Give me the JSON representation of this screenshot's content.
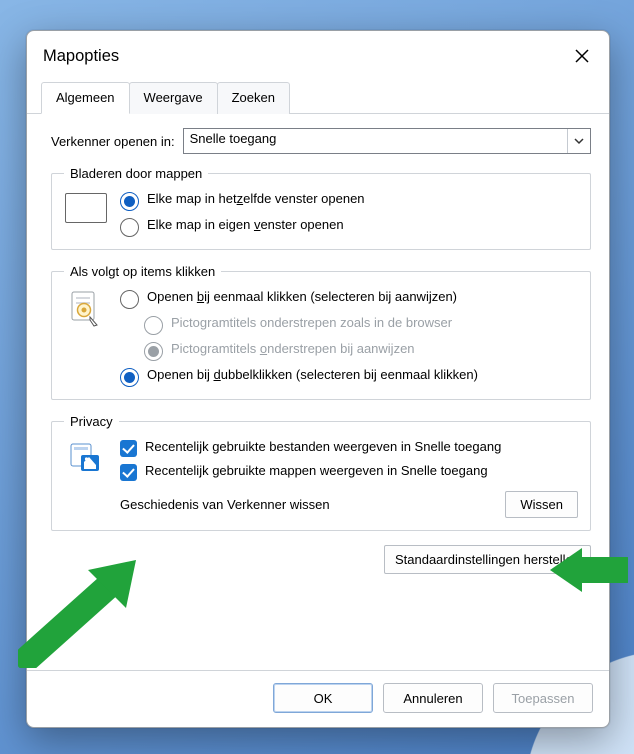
{
  "window": {
    "title": "Mapopties"
  },
  "tabs": {
    "general": "Algemeen",
    "view": "Weergave",
    "search": "Zoeken"
  },
  "open_in": {
    "label": "Verkenner openen in:",
    "value": "Snelle toegang"
  },
  "browse": {
    "legend": "Bladeren door mappen",
    "same_pre": "Elke map in het",
    "same_u": "z",
    "same_post": "elfde venster openen",
    "own_pre": "Elke map in eigen ",
    "own_u": "v",
    "own_post": "enster openen"
  },
  "click": {
    "legend": "Als volgt op items klikken",
    "single_pre": "Openen ",
    "single_u": "b",
    "single_post": "ij eenmaal klikken (selecteren bij aanwijzen)",
    "sub1": "Pictogramtitels onderstrepen zoals in de browser",
    "sub2_pre": "Pictogramtitels ",
    "sub2_u": "o",
    "sub2_post": "nderstrepen bij aanwijzen",
    "double_pre": "Openen bij ",
    "double_u": "d",
    "double_post": "ubbelklikken (selecteren bij eenmaal klikken)"
  },
  "privacy": {
    "legend": "Privacy",
    "recent_files": "Recentelijk gebruikte bestanden weergeven in Snelle toegang",
    "recent_folders": "Recentelijk gebruikte mappen weergeven in Snelle toegang",
    "clear_label": "Geschiedenis van Verkenner wissen",
    "clear_btn_u": "W",
    "clear_btn_post": "issen"
  },
  "restore_pre": "",
  "restore_u": "S",
  "restore_post": "tandaardinstellingen herstellen",
  "footer": {
    "ok": "OK",
    "cancel": "Annuleren",
    "apply": "Toepassen"
  }
}
